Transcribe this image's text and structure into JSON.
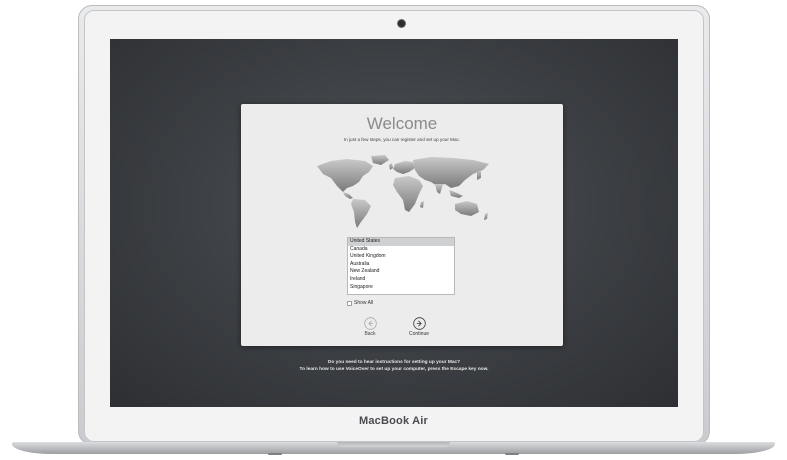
{
  "device": {
    "brand_label": "MacBook Air"
  },
  "setup": {
    "title": "Welcome",
    "subtitle": "In just a few steps, you can register and set up your Mac.",
    "countries": [
      {
        "label": "United States",
        "selected": true
      },
      {
        "label": "Canada",
        "selected": false
      },
      {
        "label": "United Kingdom",
        "selected": false
      },
      {
        "label": "Australia",
        "selected": false
      },
      {
        "label": "New Zealand",
        "selected": false
      },
      {
        "label": "Ireland",
        "selected": false
      },
      {
        "label": "Singapore",
        "selected": false
      }
    ],
    "show_all_label": "Show All",
    "show_all_checked": false,
    "back_label": "Back",
    "continue_label": "Continue"
  },
  "voiceover": {
    "line1": "Do you need to hear instructions for setting up your Mac?",
    "line2": "To learn how to use VoiceOver to set up your computer, press the Escape key now."
  },
  "colors": {
    "screen_bg": "#3b3e42",
    "dialog_bg": "#ececec",
    "selection": "#cfd0d2"
  }
}
